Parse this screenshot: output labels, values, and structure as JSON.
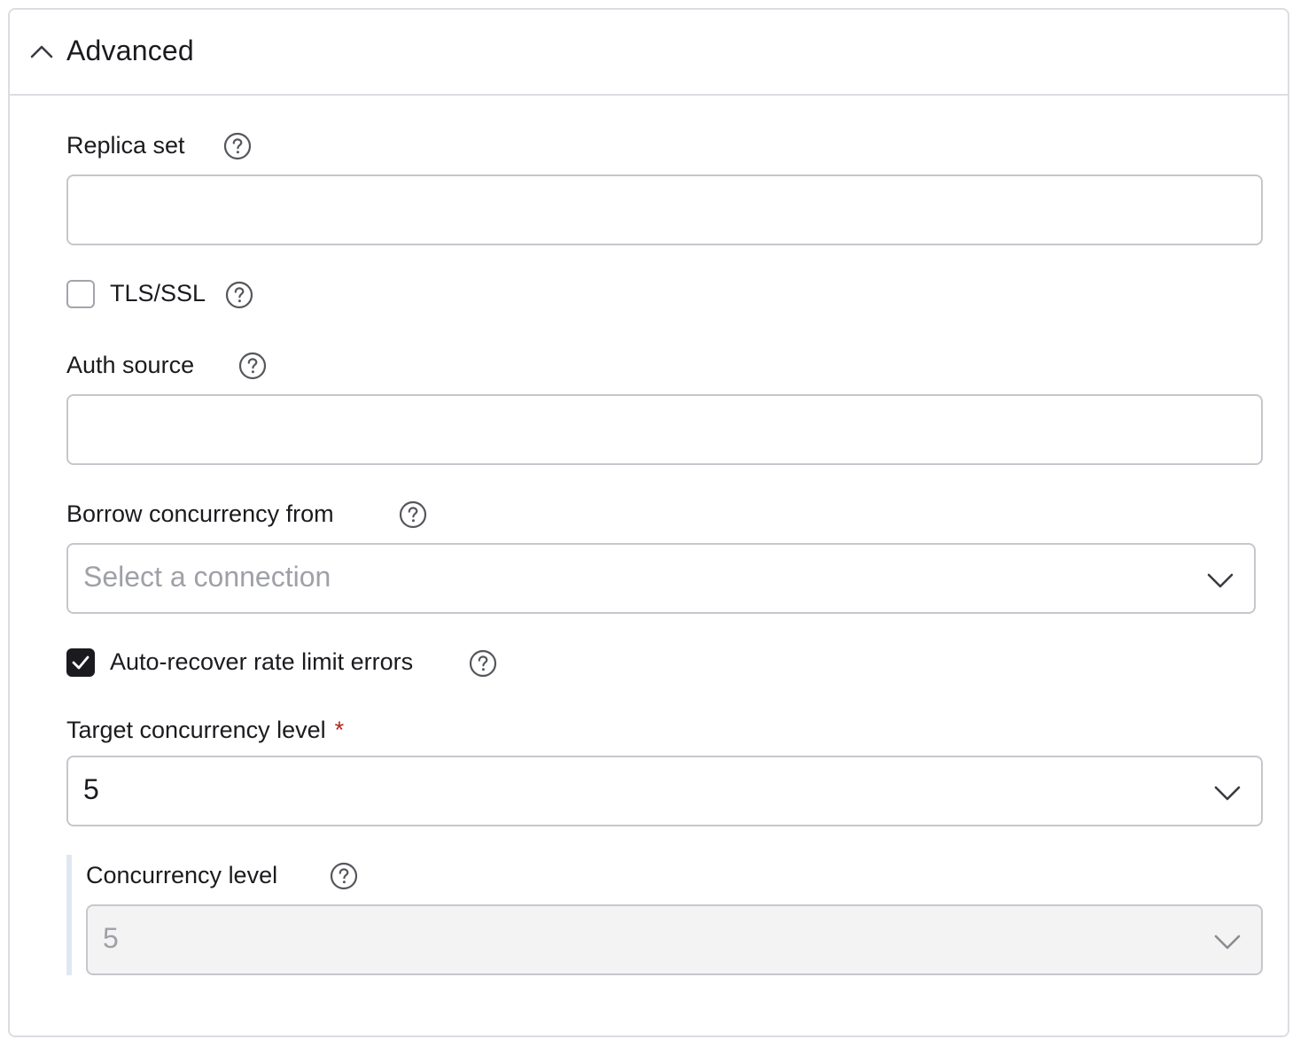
{
  "section": {
    "title": "Advanced",
    "expanded": true
  },
  "replica_set": {
    "label": "Replica set",
    "value": ""
  },
  "tls_ssl": {
    "label": "TLS/SSL",
    "checked": false
  },
  "auth_source": {
    "label": "Auth source",
    "value": ""
  },
  "borrow_concurrency": {
    "label": "Borrow concurrency from",
    "placeholder": "Select a connection"
  },
  "auto_recover": {
    "label": "Auto-recover rate limit errors",
    "checked": true
  },
  "target_concurrency": {
    "label": "Target concurrency level",
    "required_marker": "*",
    "value": "5"
  },
  "concurrency_level": {
    "label": "Concurrency level",
    "value": "5",
    "disabled": true
  },
  "icons": {
    "help": "help-circle-icon",
    "collapse": "chevron-up-icon",
    "dropdown": "chevron-down-icon",
    "check": "checkmark-icon"
  },
  "colors": {
    "border": "#c6c7cc",
    "text": "#1b1b1f",
    "required": "#b3261e",
    "disabled_bg": "#f3f3f4",
    "nested_bar": "#dfe7f1"
  }
}
